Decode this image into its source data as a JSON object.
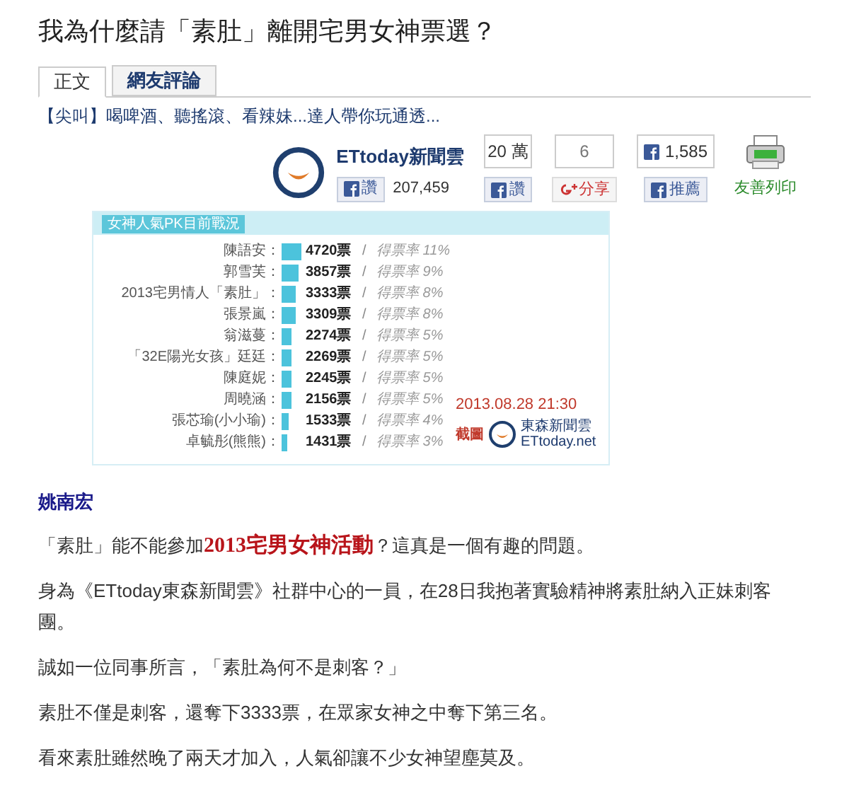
{
  "title": "我為什麼請「素肚」離開宅男女神票選？",
  "tabs": [
    {
      "label": "正文",
      "selected": true
    },
    {
      "label": "網友評論",
      "selected": false
    }
  ],
  "teaser": "【尖叫】喝啤酒、聽搖滾、看辣妹...達人帶你玩通透...",
  "publisher": {
    "name": "ETtoday新聞雲",
    "like_label": "讚",
    "like_count": "207,459"
  },
  "share": [
    {
      "kind": "like",
      "count": "20 萬",
      "label": "讚"
    },
    {
      "kind": "gplus",
      "count": "6",
      "label": "分享"
    },
    {
      "kind": "recommend",
      "count": "1,585",
      "label": "推薦"
    },
    {
      "kind": "print",
      "label": "友善列印"
    }
  ],
  "poll": {
    "title": "女神人氣PK目前戰況",
    "rows": [
      {
        "name": "陳語安：",
        "votes": "4720票",
        "sep": "/",
        "rate": "得票率 11%"
      },
      {
        "name": "郭雪芙：",
        "votes": "3857票",
        "sep": "/",
        "rate": "得票率 9%"
      },
      {
        "name": "2013宅男情人「素肚」：",
        "votes": "3333票",
        "sep": "/",
        "rate": "得票率 8%"
      },
      {
        "name": "張景嵐：",
        "votes": "3309票",
        "sep": "/",
        "rate": "得票率 8%"
      },
      {
        "name": "翁滋蔓：",
        "votes": "2274票",
        "sep": "/",
        "rate": "得票率 5%"
      },
      {
        "name": "「32E陽光女孩」廷廷：",
        "votes": "2269票",
        "sep": "/",
        "rate": "得票率 5%"
      },
      {
        "name": "陳庭妮：",
        "votes": "2245票",
        "sep": "/",
        "rate": "得票率 5%"
      },
      {
        "name": "周曉涵：",
        "votes": "2156票",
        "sep": "/",
        "rate": "得票率 5%"
      },
      {
        "name": "張芯瑜(小小瑜)：",
        "votes": "1533票",
        "sep": "/",
        "rate": "得票率 4%"
      },
      {
        "name": "卓毓彤(熊熊)：",
        "votes": "1431票",
        "sep": "/",
        "rate": "得票率 3%"
      }
    ],
    "timestamp": "2013.08.28 21:30",
    "screenshot_label": "截圖",
    "brand_name": "東森新聞雲",
    "brand_site": "ETtoday.net"
  },
  "author": "姚南宏",
  "paragraphs": [
    "「素肚」能不能參加**2013宅男女神活動**？這真是一個有趣的問題。",
    "身為《ETtoday東森新聞雲》社群中心的一員，在28日我抱著實驗精神將素肚納入正妹刺客團。",
    "誠如一位同事所言，「素肚為何不是刺客？」",
    "素肚不僅是刺客，還奪下3333票，在眾家女神之中奪下第三名。",
    "看來素肚雖然晚了兩天才加入，人氣卻讓不少女神望塵莫及。"
  ]
}
